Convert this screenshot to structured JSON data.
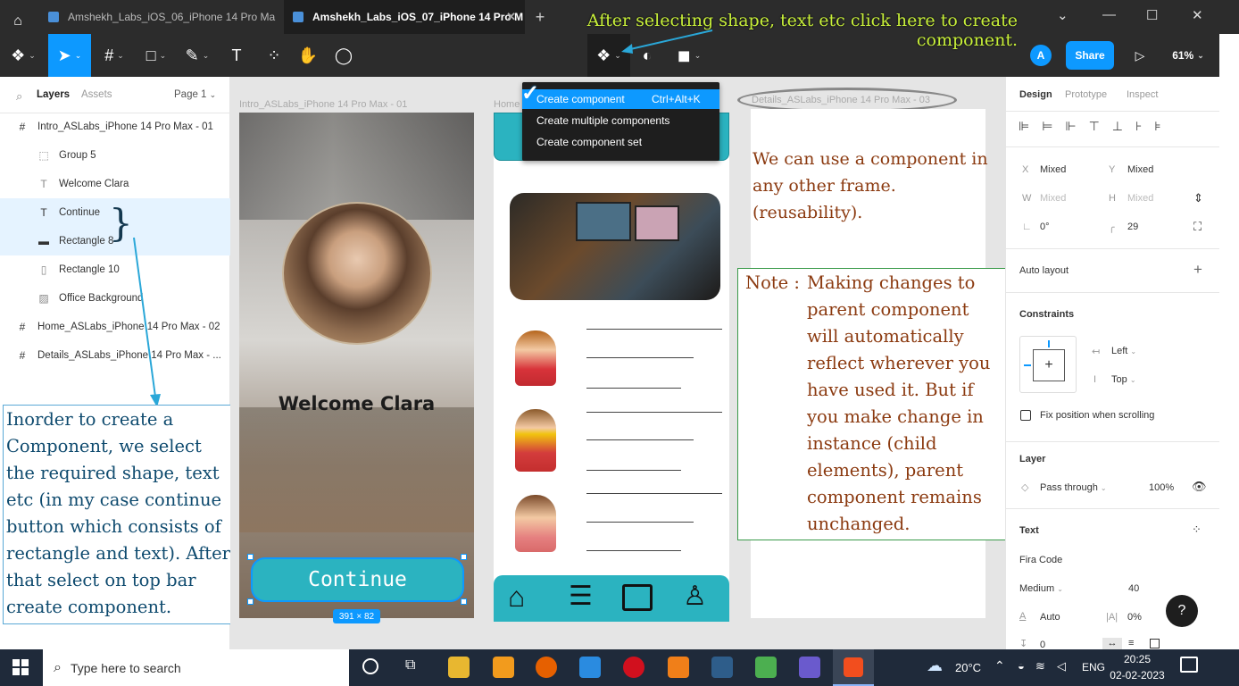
{
  "titlebar": {
    "tabs": [
      {
        "label": "Amshekh_Labs_iOS_06_iPhone 14 Pro Ma"
      },
      {
        "label": "Amshekh_Labs_iOS_07_iPhone 14 Pro M"
      }
    ]
  },
  "top_annotation": "After selecting shape, text etc click here to create component.",
  "toolbar": {
    "avatar": "A",
    "share": "Share",
    "zoom": "61%"
  },
  "dropdown": {
    "items": [
      {
        "label": "Create component",
        "shortcut": "Ctrl+Alt+K"
      },
      {
        "label": "Create multiple components",
        "shortcut": ""
      },
      {
        "label": "Create component set",
        "shortcut": ""
      }
    ]
  },
  "layers": {
    "tab_layers": "Layers",
    "tab_assets": "Assets",
    "page": "Page 1",
    "items": [
      {
        "label": "Intro_ASLabs_iPhone 14 Pro Max - 01"
      },
      {
        "label": "Group 5"
      },
      {
        "label": "Welcome Clara"
      },
      {
        "label": "Continue"
      },
      {
        "label": "Rectangle 8"
      },
      {
        "label": "Rectangle 10"
      },
      {
        "label": "Office Background"
      },
      {
        "label": "Home_ASLabs_iPhone 14 Pro Max - 02"
      },
      {
        "label": "Details_ASLabs_iPhone 14 Pro Max - ..."
      }
    ]
  },
  "left_annotation": "Inorder to create a Component, we select the required shape, text etc (in my case continue button which consists of rectangle and text). After that select on top bar create component.",
  "frames": {
    "frame1_label": "Intro_ASLabs_iPhone 14 Pro Max - 01",
    "frame2_label": "Home",
    "frame3_label": "Details_ASLabs_iPhone 14 Pro Max - 03",
    "welcome": "Welcome  Clara",
    "continue": "Continue",
    "size_badge": "391 × 82"
  },
  "note1": "We can use a component in any other frame. (reusability).",
  "note2_prefix": "Note :",
  "note2_body": "Making changes to parent component will automatically reflect wherever you have used it. But if you make change in instance (child elements), parent component remains unchanged.",
  "design": {
    "tabs": [
      "Design",
      "Prototype",
      "Inspect"
    ],
    "x_label": "X",
    "x_val": "Mixed",
    "y_label": "Y",
    "y_val": "Mixed",
    "w_label": "W",
    "w_val": "Mixed",
    "h_label": "H",
    "h_val": "Mixed",
    "rotation": "0°",
    "radius": "29",
    "auto_layout": "Auto layout",
    "constraints": "Constraints",
    "constraint_h": "Left",
    "constraint_v": "Top",
    "fix_position": "Fix position when scrolling",
    "layer": "Layer",
    "blend": "Pass through",
    "opacity": "100%",
    "text": "Text",
    "font": "Fira Code",
    "weight": "Medium",
    "size": "40",
    "line_height": "Auto",
    "letter_spacing": "0%",
    "para": "0"
  },
  "taskbar": {
    "search": "Type here to search",
    "weather": "20°C",
    "lang": "ENG",
    "time": "20:25",
    "date": "02-02-2023"
  },
  "colors": {
    "accent": "#0d99ff",
    "teal": "#2bb3c0",
    "dark": "#2c2c2c"
  }
}
